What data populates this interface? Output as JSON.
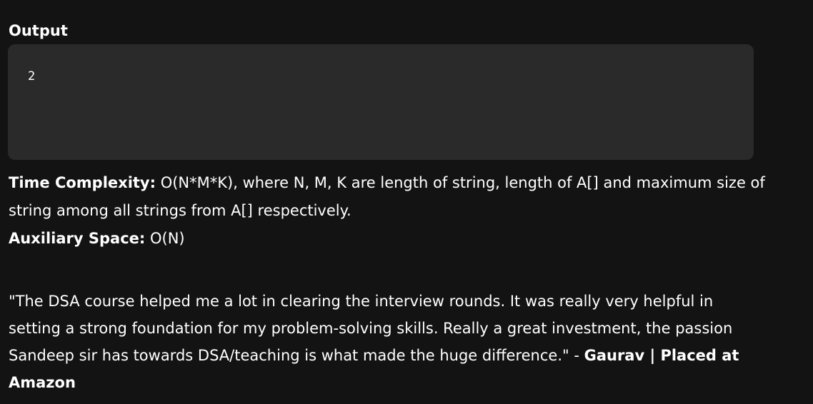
{
  "output": {
    "heading": "Output",
    "code": "2"
  },
  "complexity": {
    "time_label": "Time Complexity:",
    "time_text": " O(N*M*K), where N, M, K are length of string, length of A[] and maximum size of string among all strings from A[] respectively.",
    "space_label": "Auxiliary Space:",
    "space_text": " O(N)"
  },
  "testimonial": {
    "quote": "\"The DSA course helped me a lot in clearing the interview rounds. It was really very helpful in setting a strong foundation for my problem-solving skills. Really a great investment, the passion Sandeep sir has towards DSA/teaching is what made the huge difference.\" - ",
    "author": "Gaurav | Placed at Amazon"
  }
}
